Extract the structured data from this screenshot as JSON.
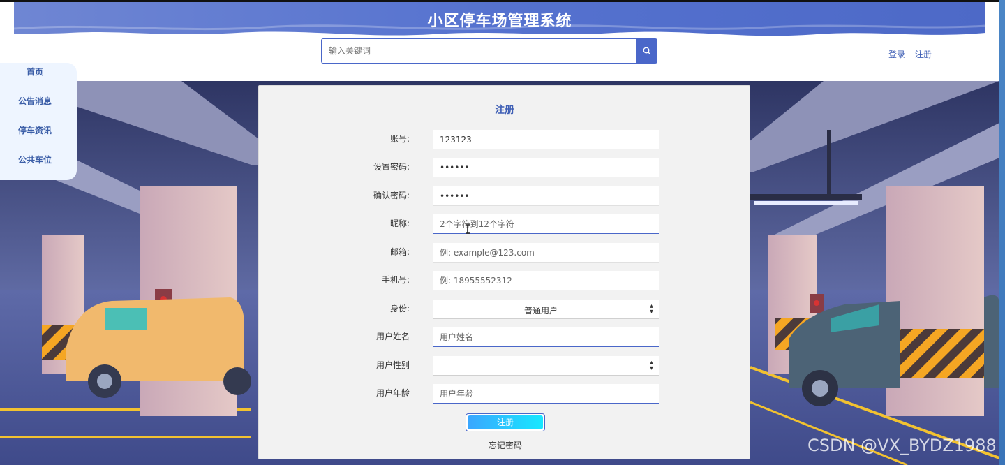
{
  "header": {
    "title": "小区停车场管理系统",
    "search_placeholder": "输入关键词",
    "login": "登录",
    "register": "注册"
  },
  "sidebar": {
    "items": [
      {
        "label": "首页"
      },
      {
        "label": "公告消息"
      },
      {
        "label": "停车资讯"
      },
      {
        "label": "公共车位"
      }
    ]
  },
  "form": {
    "title": "注册",
    "fields": [
      {
        "label": "账号:",
        "value": "123123",
        "placeholder": ""
      },
      {
        "label": "设置密码:",
        "value": "••••••",
        "placeholder": ""
      },
      {
        "label": "确认密码:",
        "value": "••••••",
        "placeholder": ""
      },
      {
        "label": "昵称:",
        "value": "",
        "placeholder": "2个字符到12个字符"
      },
      {
        "label": "邮箱:",
        "value": "",
        "placeholder": "例: example@123.com"
      },
      {
        "label": "手机号:",
        "value": "",
        "placeholder": "例: 18955552312"
      },
      {
        "label": "身份:",
        "value": "普通用户"
      },
      {
        "label": "用户姓名",
        "value": "",
        "placeholder": "用户姓名"
      },
      {
        "label": "用户性别",
        "value": ""
      },
      {
        "label": "用户年龄",
        "value": "",
        "placeholder": "用户年龄"
      }
    ],
    "submit": "注册",
    "forgot": "忘记密码"
  },
  "watermark": "CSDN @VX_BYDZ1988",
  "colors": {
    "accent": "#4a67c9",
    "link": "#3f5fb5",
    "button_gradient_start": "#3aa6ff",
    "button_gradient_end": "#18e8ff",
    "panel": "#f2f2f2",
    "sidebar": "#eef5ff"
  }
}
